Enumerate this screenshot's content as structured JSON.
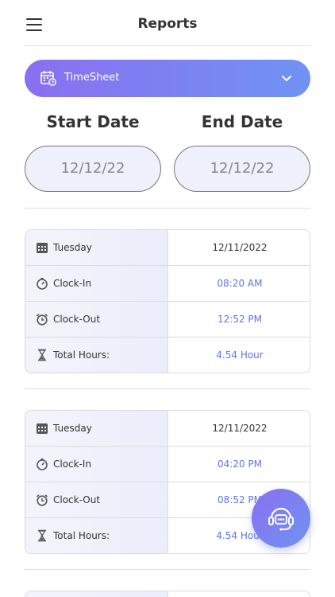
{
  "header": {
    "title": "Reports"
  },
  "report_type": {
    "selected": "TimeSheet"
  },
  "dates": {
    "start_label": "Start Date",
    "end_label": "End Date",
    "start_value": "12/12/22",
    "end_value": "12/12/22"
  },
  "entries": [
    {
      "day": "Tuesday",
      "date": "12/11/2022",
      "clock_in_label": "Clock-In",
      "clock_in": "08:20 AM",
      "clock_out_label": "Clock-Out",
      "clock_out": "12:52 PM",
      "total_label": "Total Hours:",
      "total": "4.54 Hour"
    },
    {
      "day": "Tuesday",
      "date": "12/11/2022",
      "clock_in_label": "Clock-In",
      "clock_in": "04:20 PM",
      "clock_out_label": "Clock-Out",
      "clock_out": "08:52 PM",
      "total_label": "Total Hours:",
      "total": "4.54 Hour"
    }
  ],
  "icons": {
    "menu": "hamburger-menu-icon",
    "report_type": "calendar-clock-icon",
    "dropdown": "chevron-down-icon",
    "day": "calendar-icon",
    "clock_in": "clock-in-icon",
    "clock_out": "alarm-clock-icon",
    "total": "hourglass-icon",
    "support": "headset-support-icon"
  },
  "colors": {
    "accent_start": "#8a6ff0",
    "accent_end": "#6f93f3",
    "time_value": "#5a76e8"
  }
}
